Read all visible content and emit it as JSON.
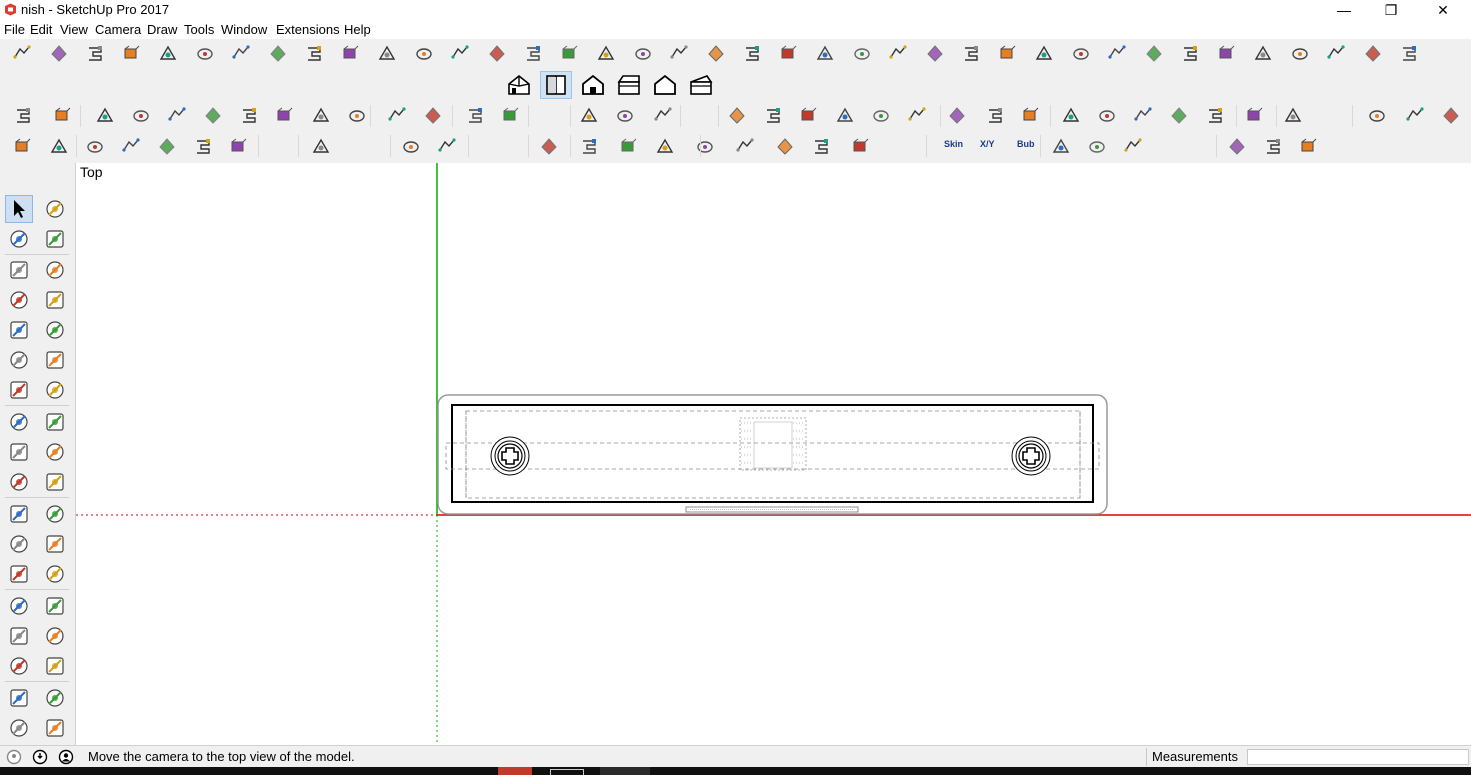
{
  "window": {
    "title": "nish - SketchUp Pro 2017",
    "minimize_glyph": "—",
    "maximize_glyph": "❐",
    "close_glyph": "✕"
  },
  "menu": [
    "File",
    "Edit",
    "View",
    "Camera",
    "Draw",
    "Tools",
    "Window",
    "Extensions",
    "Help"
  ],
  "toolbar": {
    "views": [
      "iso-view-icon",
      "top-view-icon",
      "front-view-icon",
      "right-view-icon",
      "back-view-icon",
      "left-view-icon"
    ],
    "active_view": "top-view-icon",
    "text_buttons": [
      "Skin",
      "X/Y",
      "Bub"
    ]
  },
  "left_tools": [
    [
      "select-arrow-icon",
      "make-component-icon"
    ],
    [
      "paint-bucket-icon",
      "eraser-icon"
    ],
    [
      "pencil-line-icon",
      "freehand-icon"
    ],
    [
      "rectangle-icon",
      "rotated-rectangle-icon"
    ],
    [
      "circle-icon",
      "polygon-icon"
    ],
    [
      "arc-icon",
      "two-point-arc-icon"
    ],
    [
      "three-point-arc-icon",
      "pie-icon"
    ],
    [
      "move-icon",
      "push-pull-icon"
    ],
    [
      "rotate-icon",
      "follow-me-icon"
    ],
    [
      "scale-icon",
      "offset-icon"
    ],
    [
      "tape-measure-icon",
      "dimension-icon"
    ],
    [
      "protractor-icon",
      "text-label-icon"
    ],
    [
      "axes-icon",
      "3d-text-icon"
    ],
    [
      "orbit-icon",
      "pan-hand-icon"
    ],
    [
      "zoom-icon",
      "zoom-window-icon"
    ],
    [
      "zoom-extents-icon",
      "previous-view-icon"
    ],
    [
      "position-camera-icon",
      "look-around-icon"
    ],
    [
      "walk-icon",
      "section-plane-icon"
    ]
  ],
  "viewport": {
    "view_label": "Top"
  },
  "status": {
    "message": "Move the camera to the top view of the model.",
    "measurements_label": "Measurements",
    "measurements_value": ""
  },
  "colors": {
    "red_axis": "#e00000",
    "green_axis": "#00b000",
    "ui_background": "#f0f0f0"
  }
}
